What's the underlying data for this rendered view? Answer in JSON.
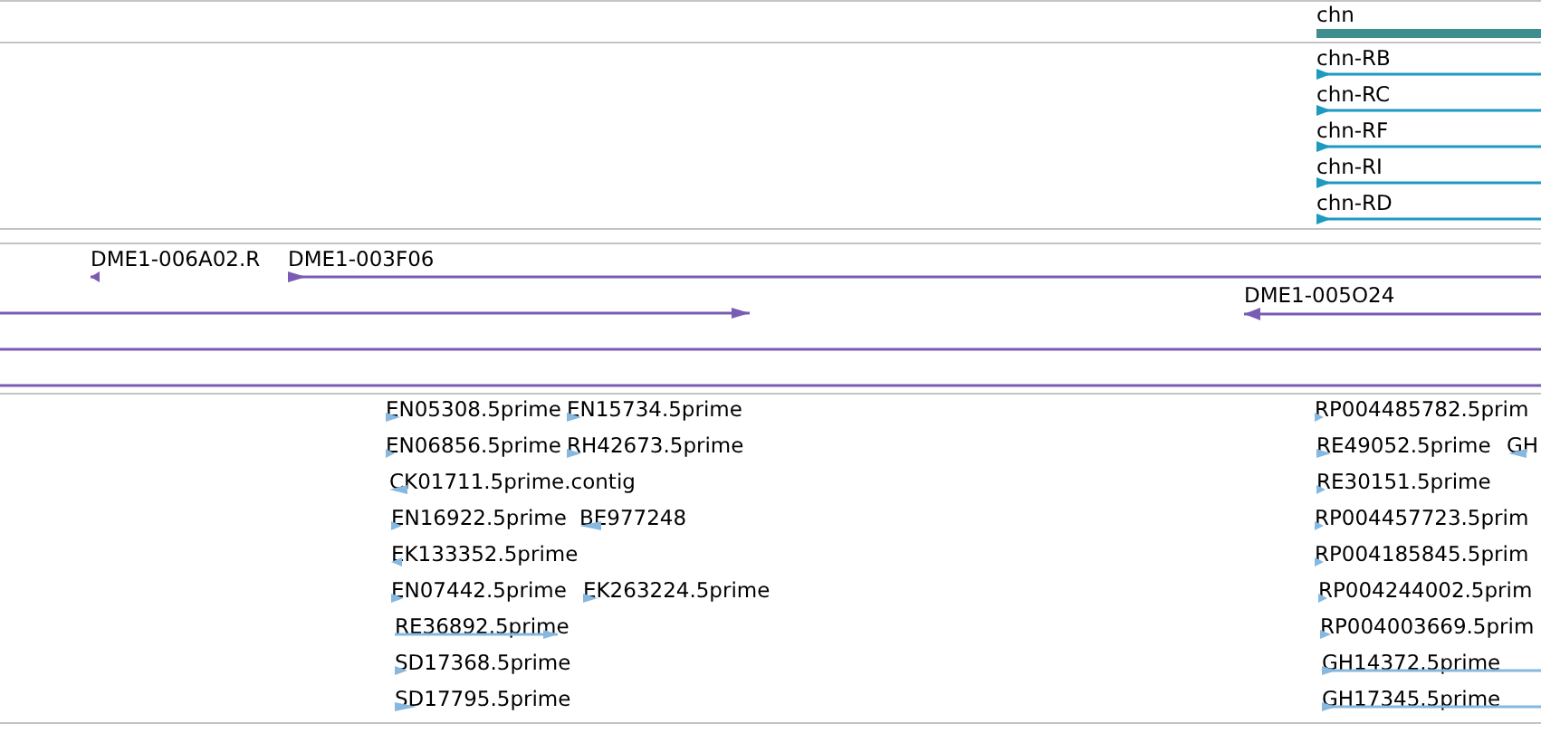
{
  "tracks": [
    {
      "kind": "gene",
      "features": [
        {
          "label": "chn"
        }
      ]
    },
    {
      "kind": "transcript",
      "features": [
        {
          "label": "chn-RB",
          "reverse": false
        },
        {
          "label": "chn-RC",
          "reverse": false
        },
        {
          "label": "chn-RF",
          "reverse": false
        },
        {
          "label": "chn-RI",
          "reverse": false
        },
        {
          "label": "chn-RD",
          "reverse": false
        }
      ]
    },
    {
      "kind": "empty"
    },
    {
      "kind": "clone",
      "features": [
        {
          "kind": "arrow",
          "label": "DME1-006A02.R",
          "reverse": true
        },
        {
          "kind": "arrow",
          "label": "DME1-003F06",
          "reverse": false
        },
        {
          "kind": "arrow",
          "reverse": false
        },
        {
          "kind": "arrow",
          "label": "DME1-005O24",
          "reverse": true
        },
        {
          "kind": "line"
        },
        {
          "kind": "line"
        }
      ]
    },
    {
      "kind": "est",
      "features": [
        {
          "label": "EN05308.5prime",
          "reverse": false
        },
        {
          "label": "EN15734.5prime",
          "reverse": false
        },
        {
          "label": "RP004485782.5prim",
          "reverse": false
        },
        {
          "label": "EN06856.5prime",
          "reverse": false
        },
        {
          "label": "RH42673.5prime",
          "reverse": false
        },
        {
          "label": "RE49052.5prime",
          "reverse": false
        },
        {
          "label": "GH",
          "reverse": true
        },
        {
          "label": "CK01711.5prime.contig",
          "reverse": true
        },
        {
          "label": "RE30151.5prime",
          "reverse": false
        },
        {
          "label": "EN16922.5prime",
          "reverse": false
        },
        {
          "label": "BE977248",
          "reverse": true
        },
        {
          "label": "RP004457723.5prim",
          "reverse": false
        },
        {
          "label": "EK133352.5prime",
          "reverse": true
        },
        {
          "label": "RP004185845.5prim",
          "reverse": false
        },
        {
          "label": "EN07442.5prime",
          "reverse": false
        },
        {
          "label": "EK263224.5prime",
          "reverse": false
        },
        {
          "label": "RP004244002.5prim",
          "reverse": false
        },
        {
          "label": "RE36892.5prime",
          "reverse": false
        },
        {
          "label": "RP004003669.5prim",
          "reverse": false
        },
        {
          "label": "SD17368.5prime",
          "reverse": false
        },
        {
          "label": "GH14372.5prime",
          "reverse": false
        },
        {
          "label": "SD17795.5prime",
          "reverse": false
        },
        {
          "label": "GH17345.5prime",
          "reverse": false
        }
      ]
    }
  ]
}
